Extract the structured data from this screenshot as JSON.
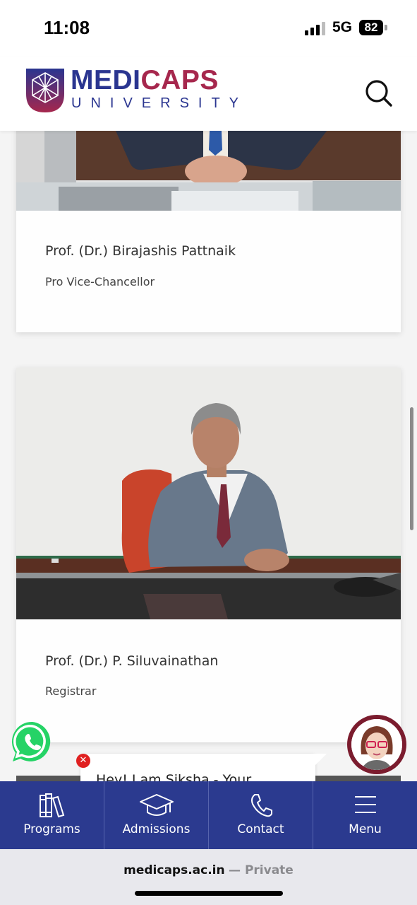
{
  "status_bar": {
    "time": "11:08",
    "network": "5G",
    "battery": "82"
  },
  "header": {
    "logo_main_pre": "MEDI",
    "logo_main_post": "CAPS",
    "logo_sub": "UNIVERSITY"
  },
  "people": [
    {
      "name": "Prof. (Dr.) Birajashis Pattnaik",
      "role": "Pro Vice-Chancellor"
    },
    {
      "name": "Prof. (Dr.) P. Siluvainathan",
      "role": "Registrar"
    }
  ],
  "chat": {
    "greeting": "Hey! I am Siksha - Your"
  },
  "bottom_nav": [
    {
      "label": "Programs",
      "icon": "books-icon"
    },
    {
      "label": "Admissions",
      "icon": "graduation-cap-icon"
    },
    {
      "label": "Contact",
      "icon": "phone-icon"
    },
    {
      "label": "Menu",
      "icon": "hamburger-menu-icon"
    }
  ],
  "browser": {
    "domain": "medicaps.ac.in",
    "mode": "— Private"
  },
  "colors": {
    "brand_blue": "#2b3a8f",
    "brand_maroon": "#a6274d",
    "whatsapp_green": "#25d366"
  }
}
